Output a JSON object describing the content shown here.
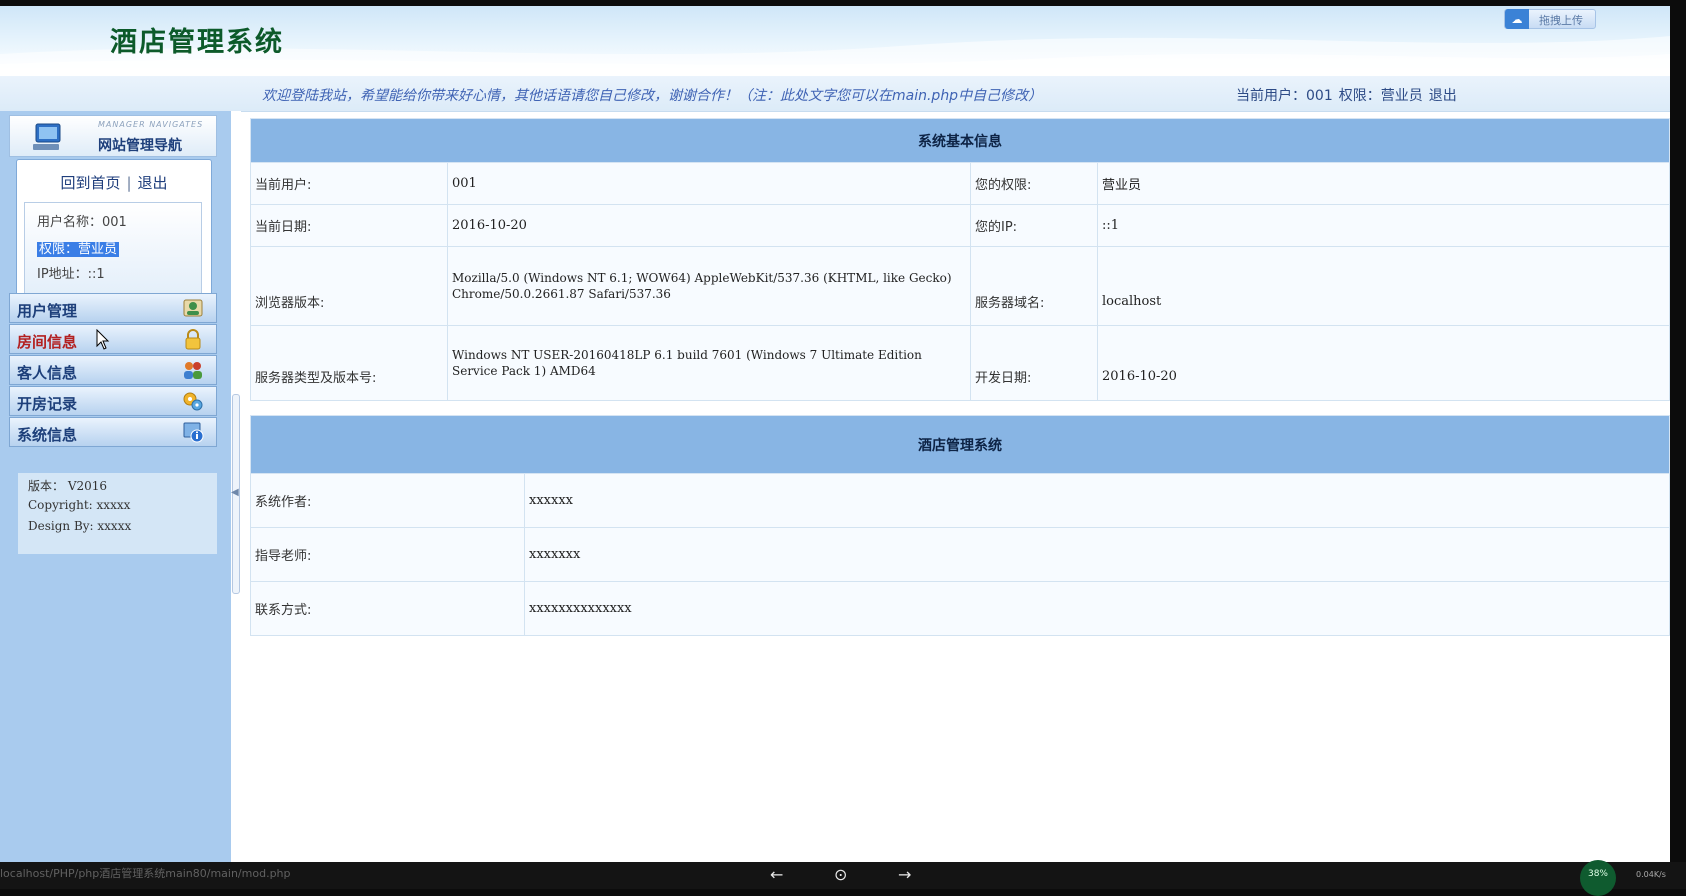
{
  "header": {
    "app_title": "酒店管理系统",
    "upload_label": "拖拽上传",
    "upload_icon": "cloud-icon"
  },
  "welcome": {
    "text": "欢迎登陆我站，希望能给你带来好心情，其他话语请您自己修改，谢谢合作！（注：此处文字您可以在main.php中自己修改）",
    "current_user_label": "当前用户：001",
    "permission_label": "权限：营业员",
    "logout_label": "退出"
  },
  "sidebar": {
    "banner_en": "MANAGER NAVIGATES",
    "banner_cn": "网站管理导航",
    "home_link": "回到首页",
    "separator": "|",
    "logout_link": "退出",
    "user_name": "用户名称：001",
    "permission": "权限：营业员",
    "ip": "IP地址：::1",
    "menu": [
      {
        "label": "用户管理",
        "icon": "user-card-icon"
      },
      {
        "label": "房间信息",
        "icon": "lock-icon"
      },
      {
        "label": "客人信息",
        "icon": "people-icon"
      },
      {
        "label": "开房记录",
        "icon": "gears-icon"
      },
      {
        "label": "系统信息",
        "icon": "info-icon"
      }
    ],
    "version": "版本： V2016",
    "copyright": "Copyright: xxxxx",
    "design_by": "Design By:  xxxxx"
  },
  "system_info": {
    "title": "系统基本信息",
    "current_user_label": "当前用户:",
    "current_user": "001",
    "permission_label": "您的权限:",
    "permission": "营业员",
    "date_label": "当前日期:",
    "date": "2016-10-20",
    "ip_label": "您的IP:",
    "ip": "::1",
    "browser_label": "浏览器版本:",
    "browser": "Mozilla/5.0 (Windows NT 6.1; WOW64) AppleWebKit/537.36 (KHTML, like Gecko) Chrome/50.0.2661.87 Safari/537.36",
    "domain_label": "服务器域名:",
    "domain": "localhost",
    "server_label": "服务器类型及版本号:",
    "server": "Windows NT USER-20160418LP 6.1 build 7601 (Windows 7 Ultimate Edition Service Pack 1) AMD64",
    "dev_date_label": "开发日期:",
    "dev_date": "2016-10-20"
  },
  "hotel_info": {
    "title": "酒店管理系统",
    "author_label": "系统作者:",
    "author": "xxxxxx",
    "teacher_label": "指导老师:",
    "teacher": "xxxxxxx",
    "contact_label": "联系方式:",
    "contact": "xxxxxxxxxxxxxx"
  },
  "taskbar": {
    "url": "localhost/PHP/php酒店管理系统main80/main/mod.php",
    "back": "←",
    "center": "⊙",
    "forward": "→",
    "percent": "38%",
    "rate": "0.04K/s"
  }
}
